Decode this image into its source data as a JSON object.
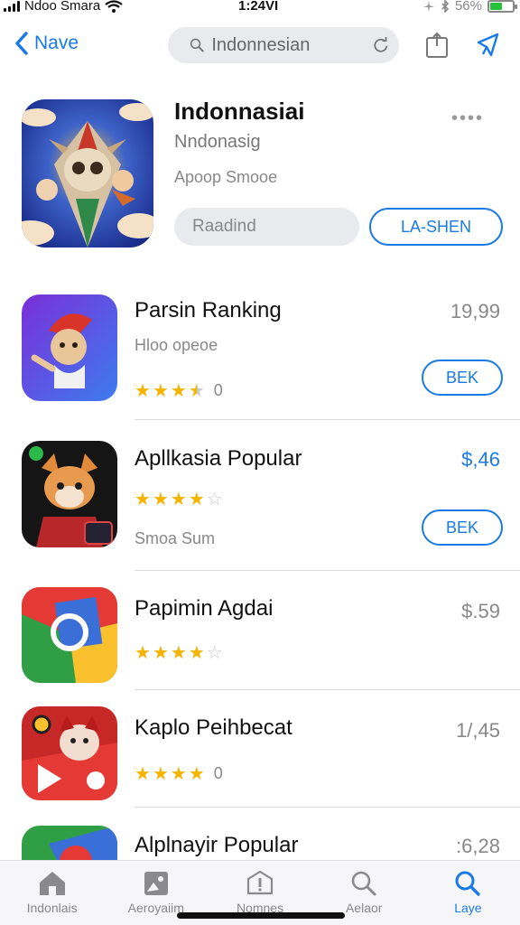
{
  "status_bar": {
    "carrier": "Ndoo Smara",
    "time": "1:24VI",
    "battery": "56%",
    "battery_level": 0.56,
    "icons": [
      "signal-icon",
      "wifi-icon",
      "bluetooth-icon",
      "battery-icon"
    ]
  },
  "nav": {
    "back_label": "Nave",
    "search_value": "Indonnesian",
    "icons": [
      "chevron-left-icon",
      "search-icon",
      "reload-icon",
      "share-icon",
      "pin-icon"
    ]
  },
  "featured": {
    "title": "Indonnasiai",
    "subtitle": "Nndonasig",
    "meta": "Apoop Smooe",
    "more": "••••",
    "secondary_button": "Raadind",
    "primary_button": "LA-SHEN"
  },
  "apps": [
    {
      "title": "Parsin Ranking",
      "price": "19,99",
      "subtitle": "Hloo opeoe",
      "rating": 3.5,
      "rating_count": "0",
      "button": "BEK"
    },
    {
      "title": "Apllkasia Popular",
      "price": "$,46",
      "subtitle": "Smoa Sum",
      "rating": 4,
      "rating_count": "",
      "button": "BEK"
    },
    {
      "title": "Papimin Agdai",
      "price": "$.59",
      "rating": 4,
      "rating_count": ""
    },
    {
      "title": "Kaplo Peihbecat",
      "price": "1/,45",
      "rating": 4,
      "rating_count": "0"
    },
    {
      "title": "Alplnayir Popular",
      "price": ":6,28"
    }
  ],
  "tabs": [
    {
      "label": "Indonlais",
      "icon": "home-icon",
      "active": false
    },
    {
      "label": "Aeroyaiim",
      "icon": "image-icon",
      "active": false
    },
    {
      "label": "Nomnes",
      "icon": "alert-icon",
      "active": false
    },
    {
      "label": "Aelaor",
      "icon": "search-icon",
      "active": false
    },
    {
      "label": "Laye",
      "icon": "search-icon",
      "active": true
    }
  ],
  "colors": {
    "accent": "#1a7ae6",
    "star": "#f5b400",
    "battery": "#27c13a"
  }
}
